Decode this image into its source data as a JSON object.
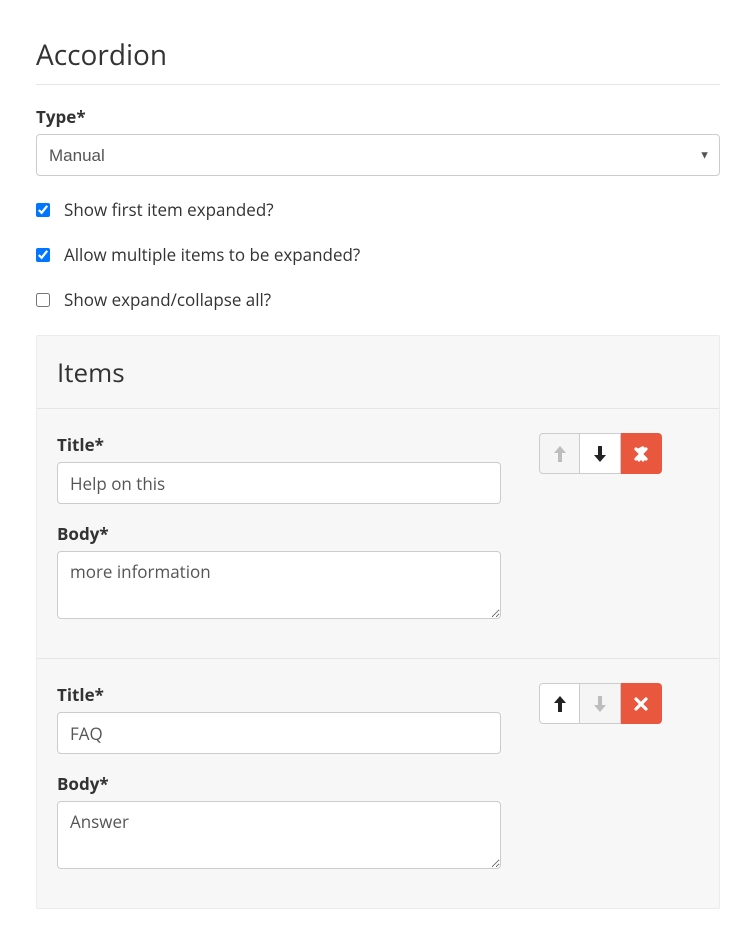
{
  "section": {
    "title": "Accordion"
  },
  "type": {
    "label": "Type*",
    "selected": "Manual"
  },
  "options": {
    "showFirstExpanded": {
      "label": "Show first item expanded?",
      "checked": true
    },
    "allowMultiple": {
      "label": "Allow multiple items to be expanded?",
      "checked": true
    },
    "showExpandCollapse": {
      "label": "Show expand/collapse all?",
      "checked": false
    }
  },
  "itemsSection": {
    "title": "Items"
  },
  "items": [
    {
      "titleLabel": "Title*",
      "titleValue": "Help on this",
      "bodyLabel": "Body*",
      "bodyValue": "more information",
      "upEnabled": false,
      "downEnabled": true
    },
    {
      "titleLabel": "Title*",
      "titleValue": "FAQ",
      "bodyLabel": "Body*",
      "bodyValue": "Answer",
      "upEnabled": true,
      "downEnabled": false
    }
  ]
}
